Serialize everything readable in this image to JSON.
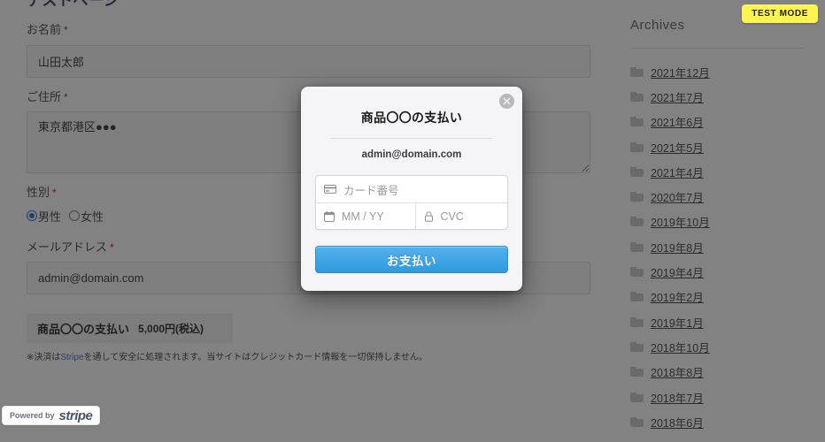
{
  "page": {
    "title": "テストページ",
    "fields": [
      {
        "label": "お名前",
        "required": true,
        "type": "text",
        "value": "山田太郎"
      },
      {
        "label": "ご住所",
        "required": true,
        "type": "textarea",
        "value": "東京都港区●●●"
      },
      {
        "label": "性別",
        "required": true,
        "type": "radio"
      },
      {
        "label": "メールアドレス",
        "required": true,
        "type": "text",
        "value": "admin@domain.com"
      }
    ],
    "gender": {
      "options": [
        {
          "label": "男性",
          "selected": true
        },
        {
          "label": "女性",
          "selected": false
        }
      ]
    },
    "product": {
      "name": "商品〇〇の支払い",
      "price": "5,000円(税込)"
    },
    "disclaimer_before": "※決済は",
    "disclaimer_highlight": "Stripe",
    "disclaimer_after": "を通して安全に処理されます。当サイトはクレジットカード情報を一切保持しません。",
    "stripe_badge": {
      "powered_by": "Powered by",
      "brand": "stripe"
    },
    "test_mode_label": "TEST MODE"
  },
  "sidebar": {
    "title": "Archives",
    "items": [
      {
        "label": "2021年12月",
        "icon": "folder-icon"
      },
      {
        "label": "2021年7月",
        "icon": "folder-icon"
      },
      {
        "label": "2021年6月",
        "icon": "folder-icon"
      },
      {
        "label": "2021年5月",
        "icon": "folder-icon"
      },
      {
        "label": "2021年4月",
        "icon": "folder-icon"
      },
      {
        "label": "2020年7月",
        "icon": "folder-icon"
      },
      {
        "label": "2019年10月",
        "icon": "folder-icon"
      },
      {
        "label": "2019年8月",
        "icon": "folder-icon"
      },
      {
        "label": "2019年4月",
        "icon": "folder-icon"
      },
      {
        "label": "2019年2月",
        "icon": "folder-icon"
      },
      {
        "label": "2019年1月",
        "icon": "folder-icon"
      },
      {
        "label": "2018年10月",
        "icon": "folder-icon"
      },
      {
        "label": "2018年8月",
        "icon": "folder-icon"
      },
      {
        "label": "2018年7月",
        "icon": "folder-icon"
      },
      {
        "label": "2018年6月",
        "icon": "folder-icon"
      }
    ]
  },
  "modal": {
    "title": "商品〇〇の支払い",
    "email": "admin@domain.com",
    "card_number_placeholder": "カード番号",
    "expiry_placeholder": "MM / YY",
    "cvc_placeholder": "CVC",
    "pay_label": "お支払い",
    "close_icon": "close-icon",
    "card_icon": "credit-card-icon",
    "calendar_icon": "calendar-icon",
    "lock_icon": "lock-icon",
    "accent_color": "#2e9ade"
  }
}
